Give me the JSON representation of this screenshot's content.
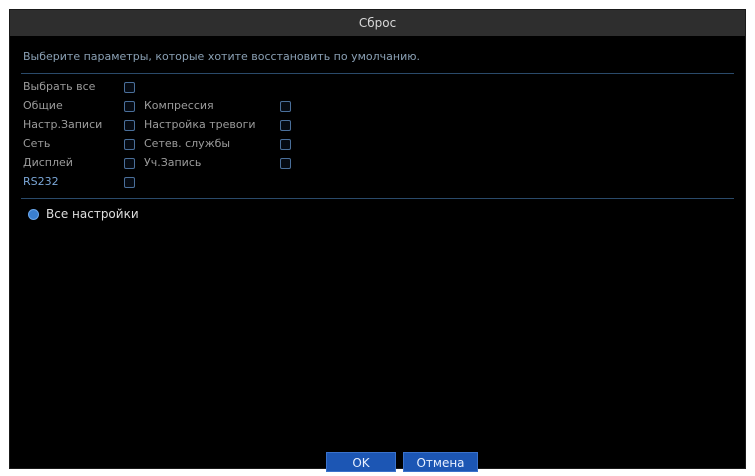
{
  "dialog": {
    "title": "Сброс",
    "subtitle": "Выберите параметры, которые хотите восстановить по умолчанию."
  },
  "options": {
    "select_all": "Выбрать все",
    "general": "Общие",
    "compression": "Компрессия",
    "record_settings": "Настр.Записи",
    "alarm_settings": "Настройка тревоги",
    "network": "Сеть",
    "network_services": "Сетев. службы",
    "display": "Дисплей",
    "account": "Уч.Запись",
    "rs232": "RS232"
  },
  "all_settings_label": "Все настройки",
  "buttons": {
    "ok": "OK",
    "cancel": "Отмена"
  }
}
